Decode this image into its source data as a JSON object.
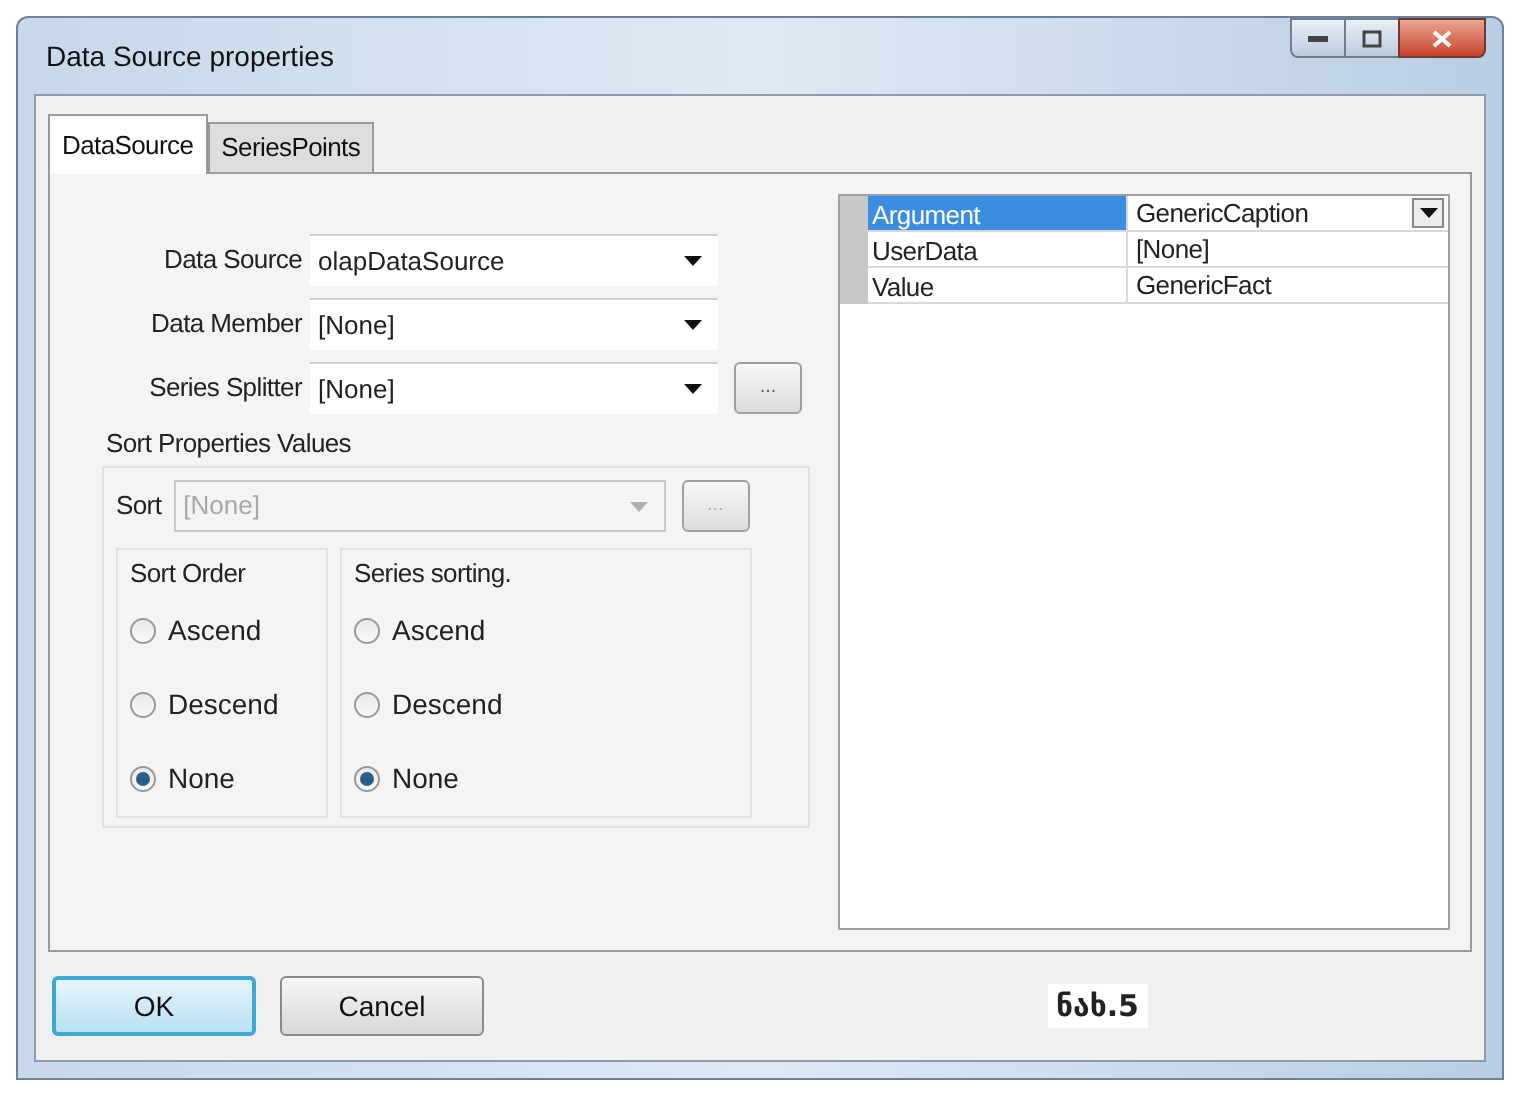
{
  "window": {
    "title": "Data Source properties"
  },
  "tabs": [
    {
      "label": "DataSource",
      "selected": true
    },
    {
      "label": "SeriesPoints",
      "selected": false
    }
  ],
  "fields": [
    {
      "label": "Data Source",
      "value": "olapDataSource"
    },
    {
      "label": "Data Member",
      "value": "[None]"
    },
    {
      "label": "Series Splitter",
      "value": "[None]",
      "ellipsis": "..."
    }
  ],
  "sort_section": {
    "title": "Sort Properties Values",
    "sort": {
      "label": "Sort",
      "value": "[None]",
      "disabled": true,
      "ellipsis": "..."
    },
    "groups": [
      {
        "title": "Sort Order",
        "options": [
          {
            "label": "Ascend",
            "selected": false
          },
          {
            "label": "Descend",
            "selected": false
          },
          {
            "label": "None",
            "selected": true
          }
        ]
      },
      {
        "title": "Series sorting.",
        "options": [
          {
            "label": "Ascend",
            "selected": false
          },
          {
            "label": "Descend",
            "selected": false
          },
          {
            "label": "None",
            "selected": true
          }
        ]
      }
    ]
  },
  "properties": [
    {
      "name": "Argument",
      "value": "GenericCaption",
      "selected": true
    },
    {
      "name": "UserData",
      "value": "[None]",
      "selected": false
    },
    {
      "name": "Value",
      "value": "GenericFact",
      "selected": false
    }
  ],
  "buttons": [
    {
      "label": "OK",
      "default": true
    },
    {
      "label": "Cancel",
      "default": false
    }
  ],
  "caption": "ნახ.5"
}
